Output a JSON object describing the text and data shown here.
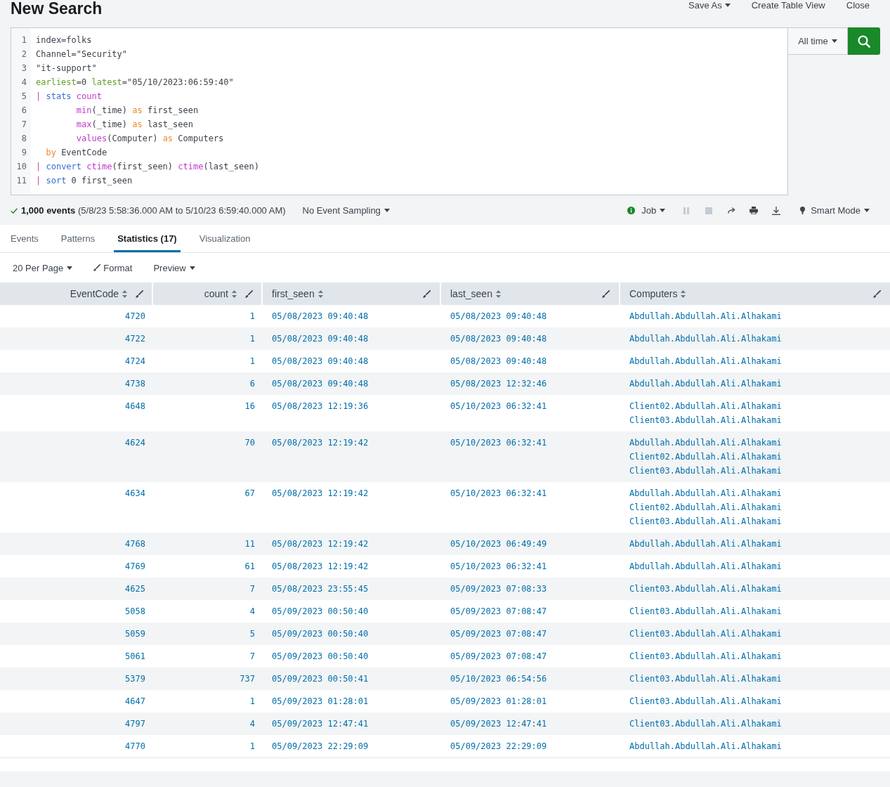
{
  "header": {
    "title": "New Search",
    "actions": [
      {
        "label": "Save As",
        "dropdown": true
      },
      {
        "label": "Create Table View",
        "dropdown": false
      },
      {
        "label": "Close",
        "dropdown": false
      }
    ]
  },
  "search": {
    "lines": [
      {
        "number": "1",
        "tokens": [
          {
            "kind": "plain",
            "text": "index=folks"
          }
        ]
      },
      {
        "number": "2",
        "tokens": [
          {
            "kind": "plain",
            "text": "Channel=\"Security\""
          }
        ]
      },
      {
        "number": "3",
        "tokens": [
          {
            "kind": "plain",
            "text": "\"it-support\""
          }
        ]
      },
      {
        "number": "4",
        "tokens": [
          {
            "kind": "argument",
            "text": "earliest"
          },
          {
            "kind": "plain",
            "text": "=0 "
          },
          {
            "kind": "argument",
            "text": "latest"
          },
          {
            "kind": "plain",
            "text": "=\"05/10/2023:06:59:40\""
          }
        ]
      },
      {
        "number": "5",
        "tokens": [
          {
            "kind": "pipe",
            "text": "| "
          },
          {
            "kind": "command",
            "text": "stats "
          },
          {
            "kind": "function",
            "text": "count"
          }
        ]
      },
      {
        "number": "6",
        "tokens": [
          {
            "kind": "function",
            "text": "        min"
          },
          {
            "kind": "plain",
            "text": "(_time) "
          },
          {
            "kind": "modifier",
            "text": "as"
          },
          {
            "kind": "plain",
            "text": " first_seen"
          }
        ]
      },
      {
        "number": "7",
        "tokens": [
          {
            "kind": "function",
            "text": "        max"
          },
          {
            "kind": "plain",
            "text": "(_time) "
          },
          {
            "kind": "modifier",
            "text": "as"
          },
          {
            "kind": "plain",
            "text": " last_seen"
          }
        ]
      },
      {
        "number": "8",
        "tokens": [
          {
            "kind": "function",
            "text": "        values"
          },
          {
            "kind": "plain",
            "text": "(Computer) "
          },
          {
            "kind": "modifier",
            "text": "as"
          },
          {
            "kind": "plain",
            "text": " Computers"
          }
        ]
      },
      {
        "number": "9",
        "tokens": [
          {
            "kind": "modifier",
            "text": "  by"
          },
          {
            "kind": "plain",
            "text": " EventCode"
          }
        ]
      },
      {
        "number": "10",
        "tokens": [
          {
            "kind": "pipe",
            "text": "| "
          },
          {
            "kind": "command",
            "text": "convert "
          },
          {
            "kind": "function",
            "text": "ctime"
          },
          {
            "kind": "plain",
            "text": "(first_seen) "
          },
          {
            "kind": "function",
            "text": "ctime"
          },
          {
            "kind": "plain",
            "text": "(last_seen)"
          }
        ]
      },
      {
        "number": "11",
        "tokens": [
          {
            "kind": "pipe",
            "text": "| "
          },
          {
            "kind": "command",
            "text": "sort"
          },
          {
            "kind": "plain",
            "text": " 0 first_seen"
          }
        ]
      }
    ],
    "time_range": "All time"
  },
  "status": {
    "summary": "**1,000 events** (5/8/23 5:58:36.000 AM to 5/10/23 6:59:40.000 AM)",
    "sampling": "No Event Sampling",
    "job": "Job",
    "job_controls": [
      {
        "kind": "pause",
        "disabled": true
      },
      {
        "kind": "stop",
        "disabled": true
      },
      {
        "kind": "share",
        "disabled": false
      },
      {
        "kind": "print",
        "disabled": false
      },
      {
        "kind": "export",
        "disabled": false
      }
    ],
    "mode": "Smart Mode"
  },
  "tabs": [
    {
      "label": "Events",
      "selected": false
    },
    {
      "label": "Patterns",
      "selected": false
    },
    {
      "label": "Statistics (17)",
      "selected": true
    },
    {
      "label": "Visualization",
      "selected": false
    }
  ],
  "table_toolbar": [
    {
      "kind": "dropdown",
      "label": "20 Per Page"
    },
    {
      "kind": "format",
      "label": "Format"
    },
    {
      "kind": "dropdown",
      "label": "Preview"
    }
  ],
  "table": {
    "columns": [
      {
        "label": "EventCode",
        "kind": "number"
      },
      {
        "label": "count",
        "kind": "number"
      },
      {
        "label": "first_seen",
        "kind": "text"
      },
      {
        "label": "last_seen",
        "kind": "text"
      },
      {
        "label": "Computers",
        "kind": "text"
      }
    ],
    "rows": [
      {
        "event_code": "4720",
        "count": "1",
        "first_seen": "05/08/2023 09:40:48",
        "last_seen": "05/08/2023 09:40:48",
        "computers": [
          "Abdullah.Abdullah.Ali.Alhakami"
        ]
      },
      {
        "event_code": "4722",
        "count": "1",
        "first_seen": "05/08/2023 09:40:48",
        "last_seen": "05/08/2023 09:40:48",
        "computers": [
          "Abdullah.Abdullah.Ali.Alhakami"
        ]
      },
      {
        "event_code": "4724",
        "count": "1",
        "first_seen": "05/08/2023 09:40:48",
        "last_seen": "05/08/2023 09:40:48",
        "computers": [
          "Abdullah.Abdullah.Ali.Alhakami"
        ]
      },
      {
        "event_code": "4738",
        "count": "6",
        "first_seen": "05/08/2023 09:40:48",
        "last_seen": "05/08/2023 12:32:46",
        "computers": [
          "Abdullah.Abdullah.Ali.Alhakami"
        ]
      },
      {
        "event_code": "4648",
        "count": "16",
        "first_seen": "05/08/2023 12:19:36",
        "last_seen": "05/10/2023 06:32:41",
        "computers": [
          "Client02.Abdullah.Ali.Alhakami",
          "Client03.Abdullah.Ali.Alhakami"
        ]
      },
      {
        "event_code": "4624",
        "count": "70",
        "first_seen": "05/08/2023 12:19:42",
        "last_seen": "05/10/2023 06:32:41",
        "computers": [
          "Abdullah.Abdullah.Ali.Alhakami",
          "Client02.Abdullah.Ali.Alhakami",
          "Client03.Abdullah.Ali.Alhakami"
        ]
      },
      {
        "event_code": "4634",
        "count": "67",
        "first_seen": "05/08/2023 12:19:42",
        "last_seen": "05/10/2023 06:32:41",
        "computers": [
          "Abdullah.Abdullah.Ali.Alhakami",
          "Client02.Abdullah.Ali.Alhakami",
          "Client03.Abdullah.Ali.Alhakami"
        ]
      },
      {
        "event_code": "4768",
        "count": "11",
        "first_seen": "05/08/2023 12:19:42",
        "last_seen": "05/10/2023 06:49:49",
        "computers": [
          "Abdullah.Abdullah.Ali.Alhakami"
        ]
      },
      {
        "event_code": "4769",
        "count": "61",
        "first_seen": "05/08/2023 12:19:42",
        "last_seen": "05/10/2023 06:32:41",
        "computers": [
          "Abdullah.Abdullah.Ali.Alhakami"
        ]
      },
      {
        "event_code": "4625",
        "count": "7",
        "first_seen": "05/08/2023 23:55:45",
        "last_seen": "05/09/2023 07:08:33",
        "computers": [
          "Client03.Abdullah.Ali.Alhakami"
        ]
      },
      {
        "event_code": "5058",
        "count": "4",
        "first_seen": "05/09/2023 00:50:40",
        "last_seen": "05/09/2023 07:08:47",
        "computers": [
          "Client03.Abdullah.Ali.Alhakami"
        ]
      },
      {
        "event_code": "5059",
        "count": "5",
        "first_seen": "05/09/2023 00:50:40",
        "last_seen": "05/09/2023 07:08:47",
        "computers": [
          "Client03.Abdullah.Ali.Alhakami"
        ]
      },
      {
        "event_code": "5061",
        "count": "7",
        "first_seen": "05/09/2023 00:50:40",
        "last_seen": "05/09/2023 07:08:47",
        "computers": [
          "Client03.Abdullah.Ali.Alhakami"
        ]
      },
      {
        "event_code": "5379",
        "count": "737",
        "first_seen": "05/09/2023 00:50:41",
        "last_seen": "05/10/2023 06:54:56",
        "computers": [
          "Client03.Abdullah.Ali.Alhakami"
        ]
      },
      {
        "event_code": "4647",
        "count": "1",
        "first_seen": "05/09/2023 01:28:01",
        "last_seen": "05/09/2023 01:28:01",
        "computers": [
          "Client03.Abdullah.Ali.Alhakami"
        ]
      },
      {
        "event_code": "4797",
        "count": "4",
        "first_seen": "05/09/2023 12:47:41",
        "last_seen": "05/09/2023 12:47:41",
        "computers": [
          "Client03.Abdullah.Ali.Alhakami"
        ]
      },
      {
        "event_code": "4770",
        "count": "1",
        "first_seen": "05/09/2023 22:29:09",
        "last_seen": "05/09/2023 22:29:09",
        "computers": [
          "Abdullah.Abdullah.Ali.Alhakami"
        ]
      }
    ]
  }
}
